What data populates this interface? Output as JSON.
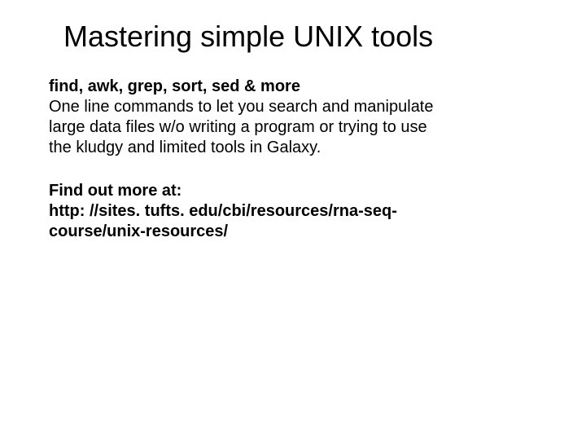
{
  "slide": {
    "title": "Mastering simple UNIX tools",
    "subtitle_bold": "find, awk, grep, sort, sed & more",
    "description": "One line commands to let you search and manipulate large data files w/o writing a program or trying to use the kludgy and limited tools in Galaxy.",
    "more_label": "Find out more at:",
    "more_url": "http: //sites. tufts. edu/cbi/resources/rna-seq-course/unix-resources/"
  }
}
